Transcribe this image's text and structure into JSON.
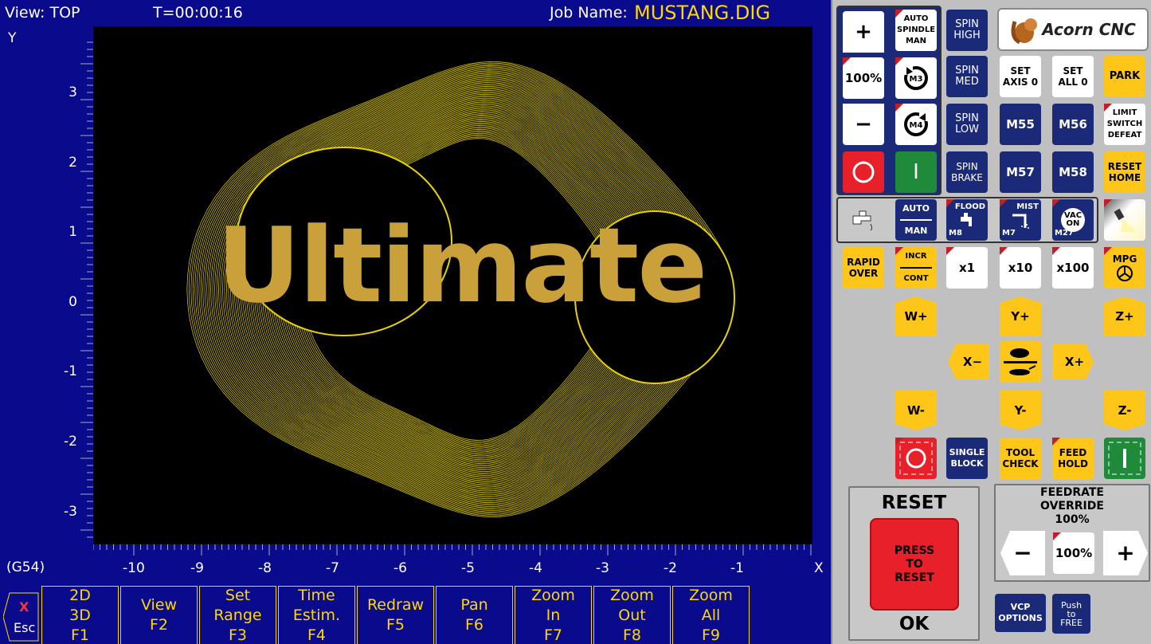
{
  "header": {
    "view": "View: TOP",
    "timer": "T=00:00:16",
    "job_label": "Job Name:",
    "job_name": "MUSTANG.DIG"
  },
  "plot": {
    "overlay_text": "Ultimate",
    "y_axis_label": "Y",
    "x_axis_label": "X",
    "coord_system": "(G54)",
    "y_ticks": [
      "3",
      "2",
      "1",
      "0",
      "-1",
      "-2",
      "-3"
    ],
    "x_ticks": [
      "-10",
      "-9",
      "-8",
      "-7",
      "-6",
      "-5",
      "-4",
      "-3",
      "-2",
      "-1"
    ]
  },
  "fkeys": [
    {
      "label": "2D\n3D",
      "key": "F1"
    },
    {
      "label": "View",
      "key": "F2"
    },
    {
      "label": "Set\nRange",
      "key": "F3"
    },
    {
      "label": "Time\nEstim.",
      "key": "F4"
    },
    {
      "label": "Redraw",
      "key": "F5"
    },
    {
      "label": "Pan",
      "key": "F6"
    },
    {
      "label": "Zoom\nIn",
      "key": "F7"
    },
    {
      "label": "Zoom\nOut",
      "key": "F8"
    },
    {
      "label": "Zoom\nAll",
      "key": "F9"
    }
  ],
  "esc": {
    "label": "Esc",
    "x": "X"
  },
  "vcp": {
    "logo": "Acorn CNC",
    "spindle_plus": "+",
    "spindle_pct": "100%",
    "spindle_minus": "−",
    "auto_spindle": "AUTO\nSPINDLE\nMAN",
    "m3": "M3",
    "m4": "M4",
    "stop_symbol": "O",
    "start_symbol": "I",
    "spin_high": "SPIN\nHIGH",
    "spin_med": "SPIN\nMED",
    "spin_low": "SPIN\nLOW",
    "spin_brake": "SPIN\nBRAKE",
    "set_axis0": "SET\nAXIS 0",
    "set_all0": "SET\nALL 0",
    "park": "PARK",
    "m55": "M55",
    "m56": "M56",
    "limit": "LIMIT\nSWITCH\nDEFEAT",
    "m57": "M57",
    "m58": "M58",
    "reset_home": "RESET\nHOME",
    "coolant_auto": "AUTO",
    "coolant_man": "MAN",
    "flood": "FLOOD",
    "m8": "M8",
    "mist": "MIST",
    "m7": "M7",
    "vac": "VAC\nON",
    "m27": "M27",
    "rapid_over": "RAPID\nOVER",
    "incr": "INCR",
    "cont": "CONT",
    "x1": "x1",
    "x10": "x10",
    "x100": "x100",
    "mpg": "MPG",
    "w_plus": "W+",
    "y_plus": "Y+",
    "z_plus": "Z+",
    "x_minus": "X−",
    "x_plus": "X+",
    "w_minus": "W-",
    "y_minus": "Y-",
    "z_minus": "Z-",
    "single_block": "SINGLE\nBLOCK",
    "tool_check": "TOOL\nCHECK",
    "feed_hold": "FEED\nHOLD",
    "reset_title": "RESET",
    "press_to_reset": "PRESS\nTO\nRESET",
    "reset_status": "OK",
    "feedrate_title": "FEEDRATE\nOVERRIDE",
    "feedrate_value": "100%",
    "feed_minus": "−",
    "feed_pct": "100%",
    "feed_plus": "+",
    "vcp_options": "VCP\nOPTIONS",
    "push_free": "Push\nto\nFREE"
  },
  "colors": {
    "background": "#0a0a8c",
    "toolpath": "#e6d200",
    "accent": "#ffc61a",
    "navy_button": "#1a2a78",
    "reset_red": "#e8202a"
  }
}
